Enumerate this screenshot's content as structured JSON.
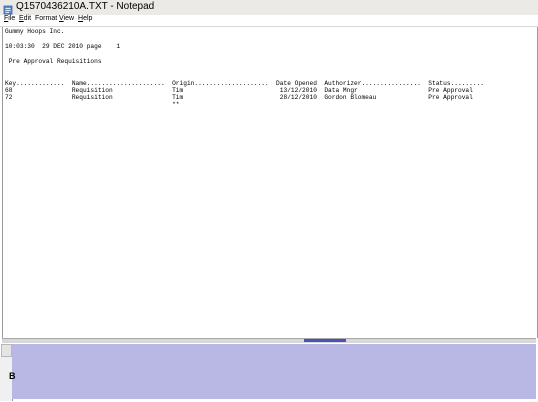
{
  "window": {
    "title": "Q1570436210A.TXT - Notepad"
  },
  "menu": [
    {
      "mnemonic": "F",
      "rest": "ile"
    },
    {
      "mnemonic": "E",
      "rest": "dit"
    },
    {
      "mnemonic": "",
      "rest": "Format"
    },
    {
      "mnemonic": "V",
      "rest": "iew"
    },
    {
      "mnemonic": "H",
      "rest": "elp"
    }
  ],
  "document": {
    "company": "Gummy Hoops Inc.",
    "timestamp_line": "10:03:30  29 DEC 2010 page    1",
    "report_title": " Pre Approval Requisitions",
    "header_line": "Key.............  Name.....................  Origin....................  Date Opened  Authorizer................  Status.........",
    "row1": "68                Requisition                Tim                          13/12/2010  Data Mngr                   Pre Approval",
    "row2": "72                Requisition                Tim                          28/12/2010  Gordon Blomeau              Pre Approval",
    "row3": "                                             **"
  },
  "bottom": {
    "glyph": "B"
  },
  "colors": {
    "scroll_thumb": "#4a52b8",
    "panel": "#b9b7e3"
  }
}
